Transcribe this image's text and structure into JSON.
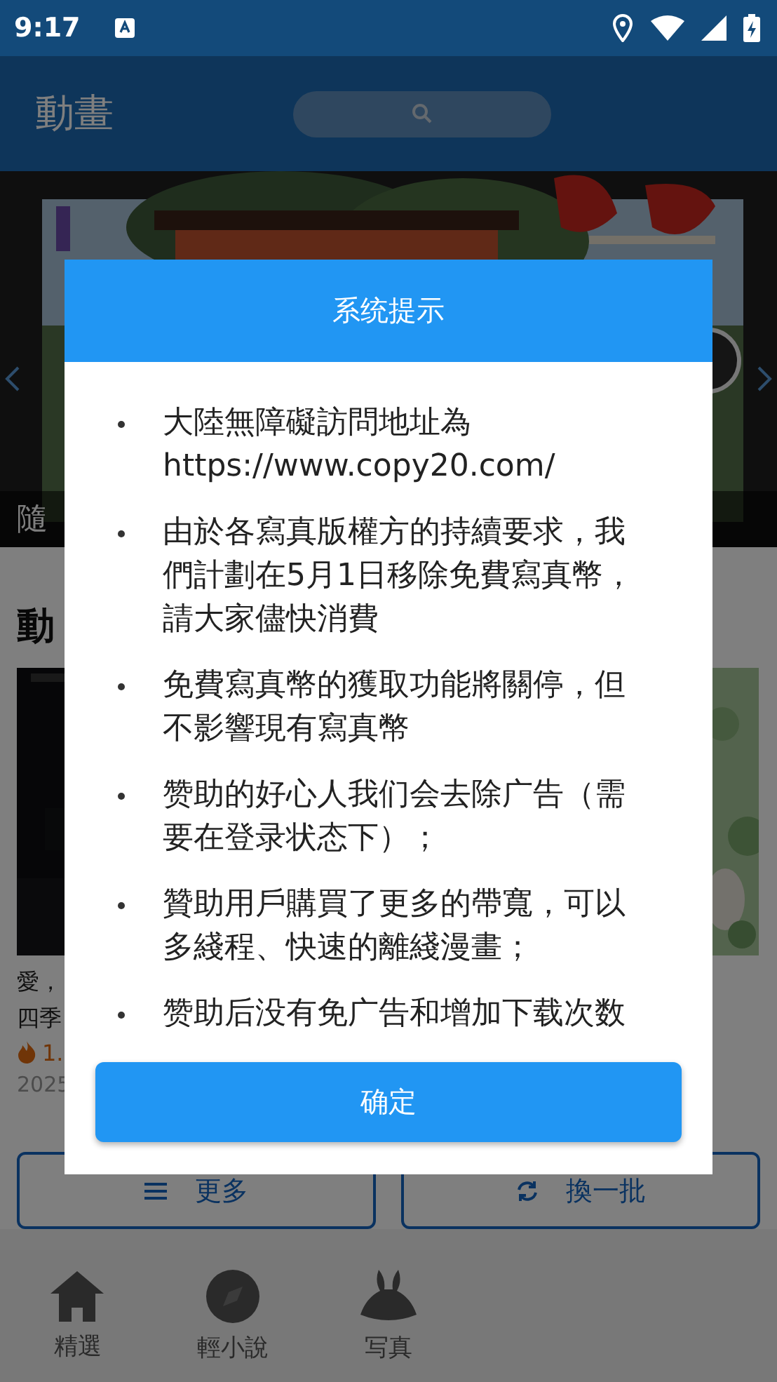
{
  "status_bar": {
    "time": "9:17"
  },
  "app_bar": {
    "title": "動畫"
  },
  "banner": {
    "kind": "picture",
    "caption": "隨"
  },
  "section": {
    "title": "動"
  },
  "cards": [
    {
      "kind": "picture",
      "lines": [
        "愛，",
        "四季"
      ],
      "heat": "1.",
      "date": "2025"
    },
    {
      "kind": "picture"
    }
  ],
  "actions": [
    {
      "kind": "more",
      "label": "更多"
    },
    {
      "kind": "refresh",
      "label": "換一批"
    }
  ],
  "bottom_nav": [
    {
      "kind": "home",
      "label": "精選"
    },
    {
      "kind": "compass",
      "label": "輕小說"
    },
    {
      "kind": "bunny",
      "label": "写真"
    }
  ],
  "dialog": {
    "title": "系统提示",
    "items": [
      "大陸無障礙訪問地址為https://www.copy20.com/",
      "由於各寫真版權方的持續要求，我們計劃在5月1日移除免費寫真幣，請大家儘快消費",
      "免費寫真幣的獲取功能將關停，但不影響現有寫真幣",
      "赞助的好心人我们会去除广告（需要在登录状态下）；",
      "贊助用戶購買了更多的帶寬，可以多綫程、快速的離綫漫畫；",
      "赞助后没有免广告和增加下载次数"
    ],
    "confirm": "确定"
  }
}
